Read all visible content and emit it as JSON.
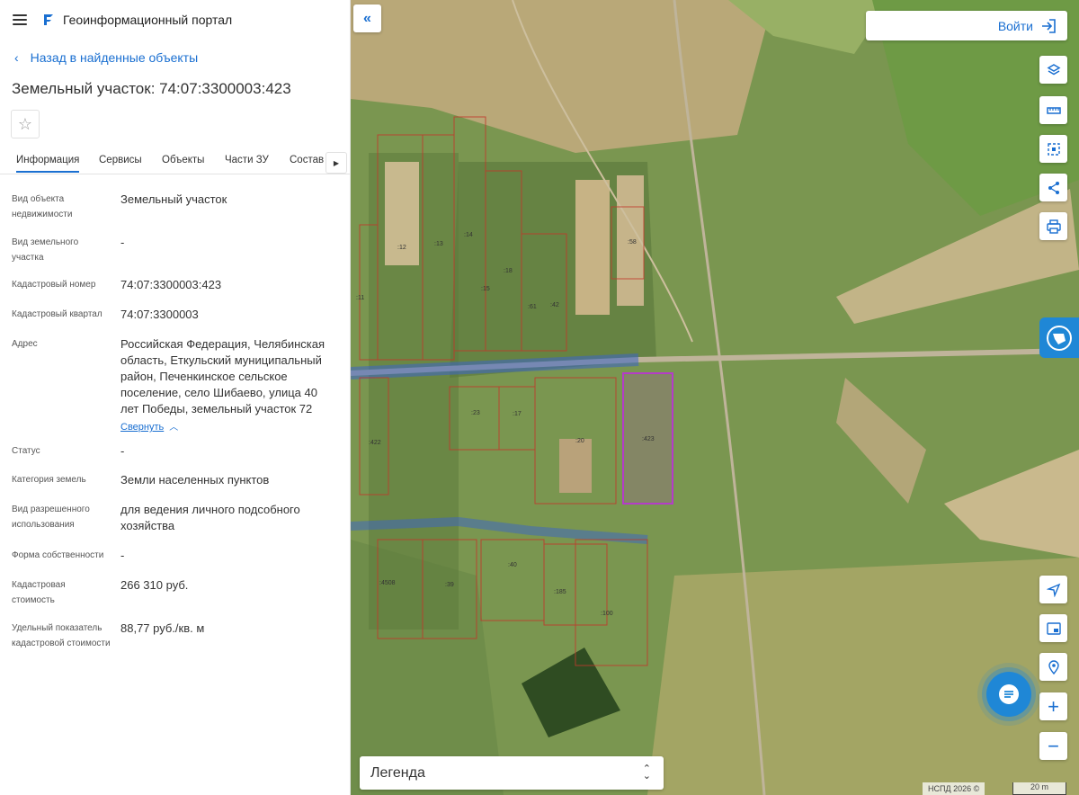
{
  "header": {
    "app_title": "Геоинформационный портал"
  },
  "nav": {
    "back_label": "Назад в найденные объекты"
  },
  "object": {
    "title": "Земельный участок: 74:07:3300003:423"
  },
  "tabs": [
    {
      "label": "Информация",
      "active": true
    },
    {
      "label": "Сервисы"
    },
    {
      "label": "Объекты"
    },
    {
      "label": "Части ЗУ"
    },
    {
      "label": "Состав"
    }
  ],
  "fields": [
    {
      "label": "Вид объекта недвижимости",
      "value": "Земельный участок"
    },
    {
      "label": "Вид земельного участка",
      "value": "-"
    },
    {
      "label": "Кадастровый номер",
      "value": "74:07:3300003:423"
    },
    {
      "label": "Кадастровый квартал",
      "value": "74:07:3300003"
    },
    {
      "label": "Адрес",
      "value": "Российская Федерация, Челябинская область, Еткульский муниципальный район, Печенкинское сельское поселение, село Шибаево, улица 40 лет Победы, земельный участок 72",
      "action": "Свернуть"
    },
    {
      "label": "Статус",
      "value": "-"
    },
    {
      "label": "Категория земель",
      "value": "Земли населенных пунктов"
    },
    {
      "label": "Вид разрешенного использования",
      "value": "для ведения личного подсобного хозяйства"
    },
    {
      "label": "Форма собственности",
      "value": "-"
    },
    {
      "label": "Кадастровая стоимость",
      "value": "266 310 руб."
    },
    {
      "label": "Удельный показатель кадастровой стоимости",
      "value": "88,77 руб./кв. м"
    }
  ],
  "map": {
    "login_label": "Войти",
    "legend_label": "Легенда",
    "attribution": "НСПД 2026 ©",
    "scale_label": "20 m",
    "parcel_labels": [
      "12",
      "13",
      "14",
      "18",
      "15",
      "61",
      "42",
      "58",
      "11",
      "23",
      "17",
      "20",
      "423",
      "422",
      "40",
      "4508",
      "39",
      "185",
      "100"
    ],
    "highlight_color": "#b43cc8",
    "accent_color": "#1a6fd1"
  }
}
